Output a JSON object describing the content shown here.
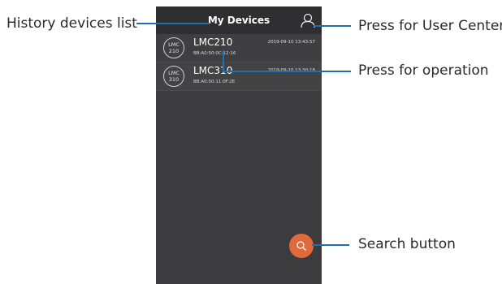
{
  "app": {
    "title": "My Devices"
  },
  "devices": [
    {
      "badge_top": "LMC",
      "badge_bottom": "210",
      "name": "LMC210",
      "mac": "BB:A0:50:0C:12:16",
      "time": "2019-09-10 13:43:57"
    },
    {
      "badge_top": "LMC",
      "badge_bottom": "310",
      "name": "LMC310",
      "mac": "BB:A0:50:11:0F:2E",
      "time": "2019-09-10 13:30:18"
    }
  ],
  "icons": {
    "user": "user-icon",
    "search": "search-icon"
  },
  "colors": {
    "background": "#3c3c3e",
    "accent": "#e06a3b",
    "callout_line": "#1f6fb0"
  },
  "annotations": {
    "history": "History devices list",
    "user_center": "Press for User Center",
    "operation": "Press for operation",
    "search": "Search button"
  }
}
